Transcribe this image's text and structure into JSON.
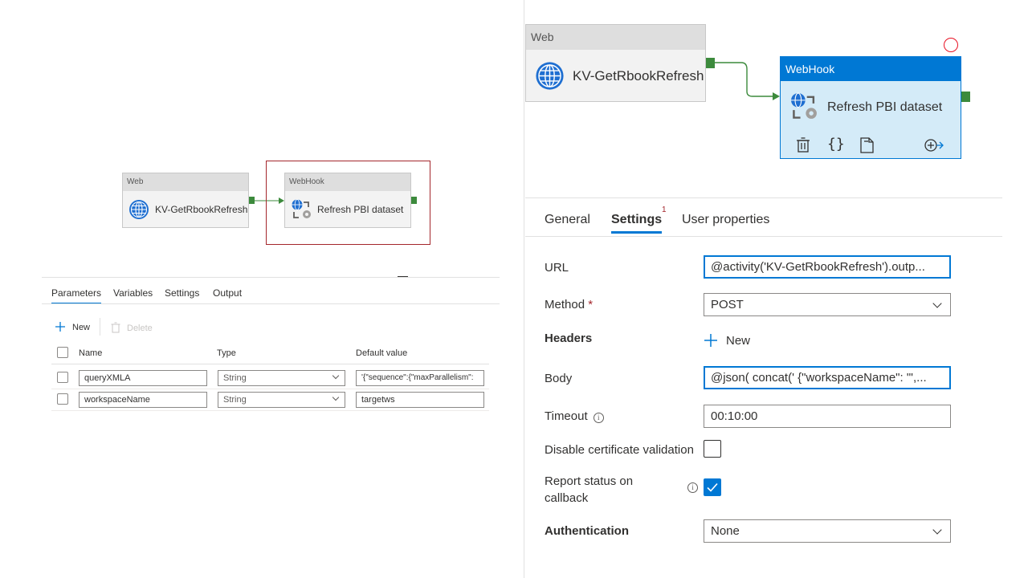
{
  "left_canvas": {
    "web_node": {
      "type": "Web",
      "name": "KV-GetRbookRefresh",
      "icon": "globe-icon"
    },
    "webhook_node": {
      "type": "WebHook",
      "name": "Refresh PBI dataset",
      "icon": "webhook-icon"
    },
    "highlight_color": "#a4262c"
  },
  "left_panel": {
    "tabs": [
      "Parameters",
      "Variables",
      "Settings",
      "Output"
    ],
    "active_tab": "Parameters",
    "toolbar": {
      "new_label": "New",
      "delete_label": "Delete"
    },
    "columns": [
      "Name",
      "Type",
      "Default value"
    ],
    "rows": [
      {
        "name": "queryXMLA",
        "type": "String",
        "default": "'{\"sequence\":{\"maxParallelism\":"
      },
      {
        "name": "workspaceName",
        "type": "String",
        "default": "targetws"
      }
    ]
  },
  "right_canvas": {
    "web_node": {
      "type": "Web",
      "name": "KV-GetRbookRefresh",
      "icon": "globe-icon"
    },
    "webhook_node": {
      "type": "WebHook",
      "name": "Refresh PBI dataset",
      "icon": "webhook-icon"
    },
    "accent": "#0078d4"
  },
  "right_panel": {
    "tabs": [
      {
        "label": "General"
      },
      {
        "label": "Settings",
        "badge": "1"
      },
      {
        "label": "User properties"
      }
    ],
    "active_tab": "Settings",
    "form": {
      "url_label": "URL",
      "url_value": "@activity('KV-GetRbookRefresh').outp...",
      "method_label": "Method",
      "method_required": "*",
      "method_value": "POST",
      "headers_label": "Headers",
      "headers_new": "New",
      "body_label": "Body",
      "body_value": "@json( concat(' {\"workspaceName\": \"',...",
      "timeout_label": "Timeout",
      "timeout_value": "00:10:00",
      "disable_cert_label": "Disable certificate validation",
      "disable_cert_checked": false,
      "report_status_label_1": "Report status on",
      "report_status_label_2": "callback",
      "report_status_checked": true,
      "auth_label": "Authentication",
      "auth_value": "None"
    }
  }
}
